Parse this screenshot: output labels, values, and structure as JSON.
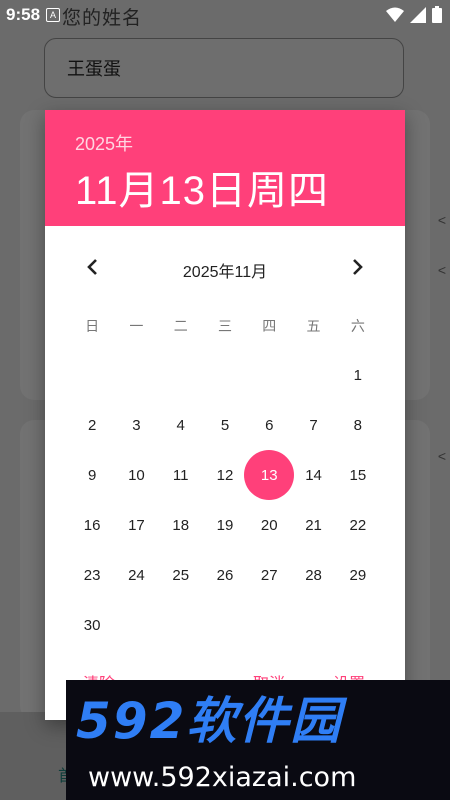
{
  "status_bar": {
    "time": "9:58",
    "notice_icon_letter": "A"
  },
  "background": {
    "field_label": "您的姓名",
    "name_value": "王蛋蛋",
    "side_marks": [
      "<",
      "<",
      "<"
    ],
    "bottom_text": "首"
  },
  "dialog": {
    "header_year": "2025年",
    "header_date": "11月13日周四",
    "month_label": "2025年11月",
    "weekdays": [
      "日",
      "一",
      "二",
      "三",
      "四",
      "五",
      "六"
    ],
    "weeks": [
      [
        "",
        "",
        "",
        "",
        "",
        "",
        "1"
      ],
      [
        "2",
        "3",
        "4",
        "5",
        "6",
        "7",
        "8"
      ],
      [
        "9",
        "10",
        "11",
        "12",
        "13",
        "14",
        "15"
      ],
      [
        "16",
        "17",
        "18",
        "19",
        "20",
        "21",
        "22"
      ],
      [
        "23",
        "24",
        "25",
        "26",
        "27",
        "28",
        "29"
      ],
      [
        "30",
        "",
        "",
        "",
        "",
        "",
        ""
      ]
    ],
    "selected_day": "13",
    "actions": {
      "clear": "清除",
      "cancel": "取消",
      "set": "设置"
    }
  },
  "watermark": {
    "brand": "592软件园",
    "url": "www.592xiazai.com"
  },
  "colors": {
    "accent": "#ff407a",
    "scrim": "#6b6b6b",
    "watermark_bg": "#0a0a12",
    "watermark_blue": "#2f7ef5"
  }
}
